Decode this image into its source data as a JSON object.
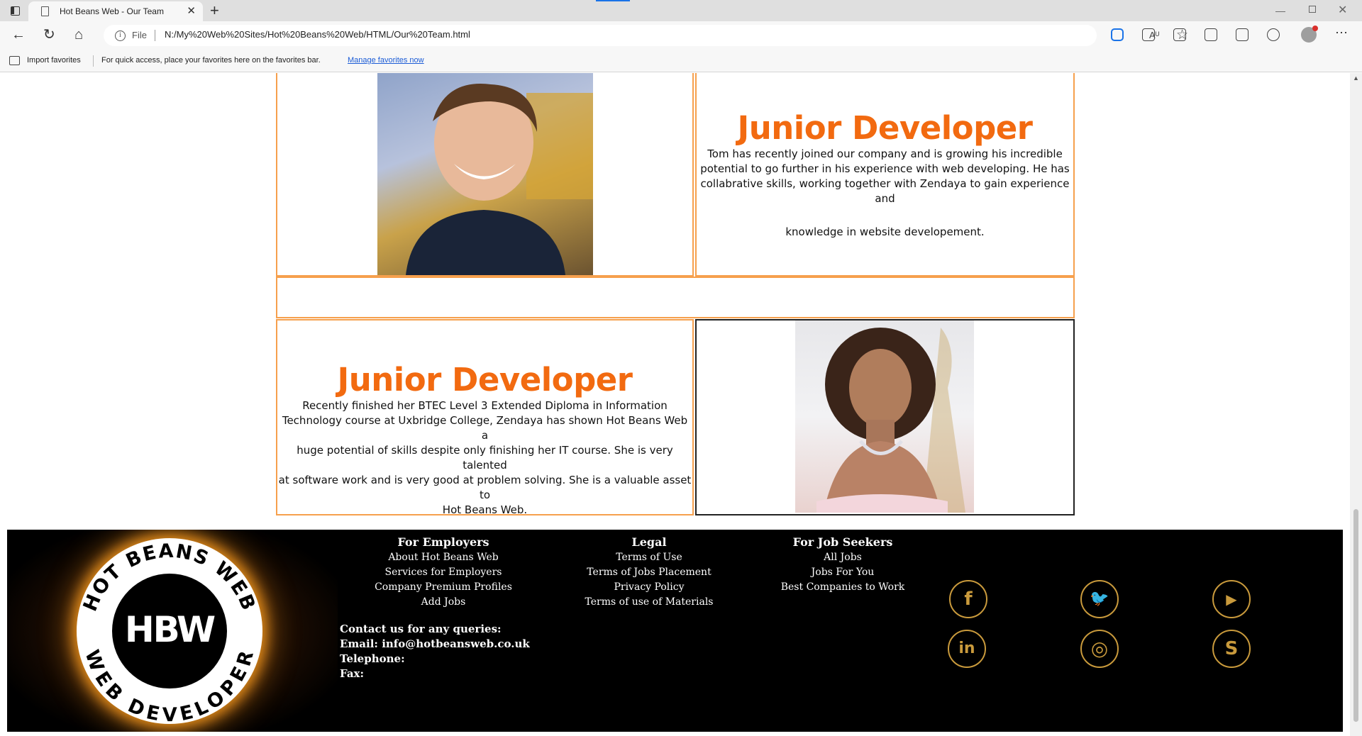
{
  "browser": {
    "tab_title": "Hot Beans Web - Our Team",
    "new_tab_glyph": "+",
    "file_label": "File",
    "url": "N:/My%20Web%20Sites/Hot%20Beans%20Web/HTML/Our%20Team.html",
    "read_aloud": "Aᵁ",
    "favorites": {
      "import_label": "Import favorites",
      "message": "For quick access, place your favorites here on the favorites bar.",
      "manage_link": "Manage favorites now"
    }
  },
  "team": [
    {
      "role": "Junior Developer",
      "bio_lines": [
        "Tom has recently joined our company and is growing his incredible",
        "potential to go further in his experience with web developing. He has",
        "collabrative skills, working together with Zendaya to gain experience and"
      ],
      "bio_tail": "knowledge in website developement."
    },
    {
      "role": "Junior Developer",
      "bio_lines": [
        "Recently finished her BTEC Level 3 Extended Diploma in Information",
        "Technology course at Uxbridge College, Zendaya has shown Hot Beans Web a",
        "huge potential of skills despite only finishing her IT course. She is very talented",
        "at software work and is very good at problem solving. She is a valuable asset to",
        "Hot Beans Web."
      ]
    }
  ],
  "footer": {
    "logo": {
      "top_text": "HOT BEANS WEB",
      "letters": "HBW",
      "bottom_text": "WEB DEVELOPER"
    },
    "employers": {
      "heading": "For Employers",
      "links": [
        "About Hot Beans Web",
        "Services for Employers",
        "Company Premium Profiles",
        "Add Jobs"
      ]
    },
    "legal": {
      "heading": "Legal",
      "links": [
        "Terms of Use",
        "Terms of Jobs Placement",
        "Privacy Policy",
        "Terms of use of Materials"
      ]
    },
    "seekers": {
      "heading": "For Job Seekers",
      "links": [
        "All Jobs",
        "Jobs For You",
        "Best Companies to Work"
      ]
    },
    "contact": {
      "heading": "Contact us for any queries:",
      "email_label": "Email:",
      "email": "info@hotbeansweb.co.uk",
      "telephone_label": "Telephone:",
      "fax_label": "Fax:"
    },
    "social": {
      "facebook": "f",
      "twitter": "🐦",
      "youtube": "▶",
      "linkedin": "in",
      "instagram": "◎",
      "skype": "S"
    },
    "brand_color": "#f26a10",
    "social_color": "#c99a3c"
  }
}
